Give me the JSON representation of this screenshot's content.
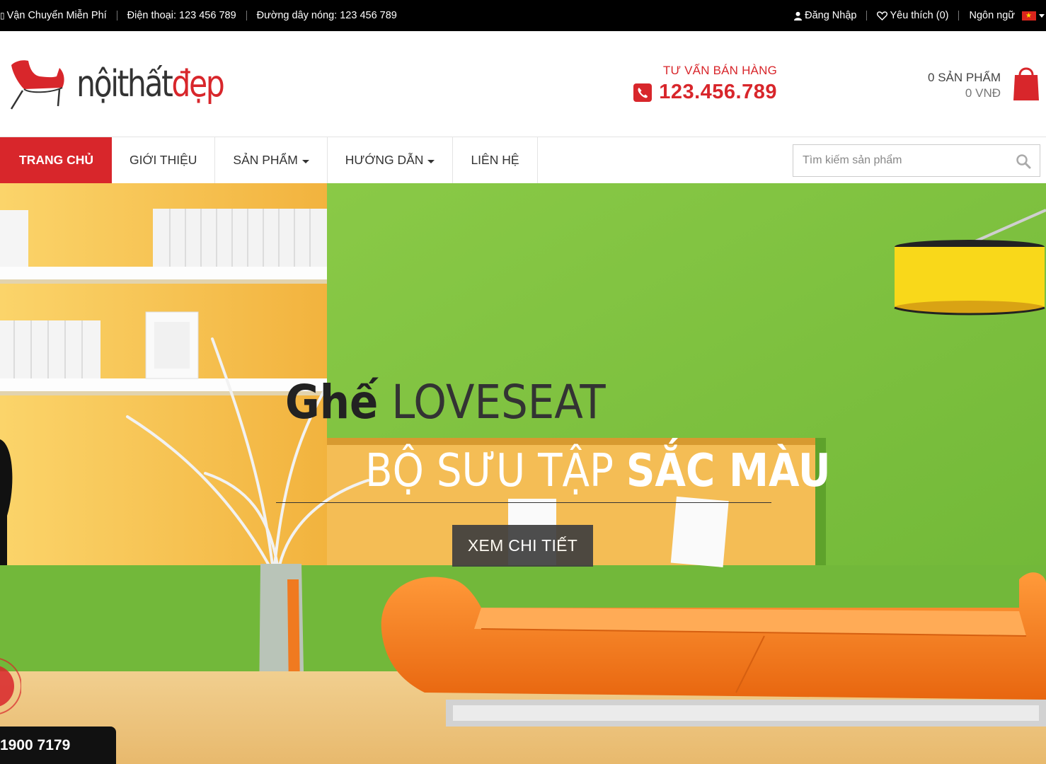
{
  "topbar": {
    "shipping": "Vận Chuyển Miễn Phí",
    "phone": "Điện thoại: 123 456 789",
    "hotline": "Đường dây nóng: 123 456 789",
    "login": "Đăng Nhập",
    "wishlist": "Yêu thích (0)",
    "language": "Ngôn ngữ"
  },
  "header": {
    "logo_dark": "nộithất",
    "logo_red": "đẹp",
    "consult_label": "TƯ VẤN BÁN HÀNG",
    "consult_number": "123.456.789",
    "cart_count": "0 SẢN PHẨM",
    "cart_total": "0 VNĐ"
  },
  "nav": {
    "items": [
      {
        "label": "TRANG CHỦ"
      },
      {
        "label": "GIỚI THIỆU"
      },
      {
        "label": "SẢN PHẨM"
      },
      {
        "label": "HƯỚNG DẪN"
      },
      {
        "label": "LIÊN HỆ"
      }
    ],
    "search_placeholder": "Tìm kiếm sản phẩm"
  },
  "slide": {
    "title_bold": "Ghế",
    "title_thin": "LOVESEAT",
    "subtitle_thin": "BỘ SƯU TẬP",
    "subtitle_bold": "SẮC MÀU",
    "button": "XEM CHI TIẾT"
  },
  "floating": {
    "phone": "1900 7179"
  },
  "colors": {
    "brand_red": "#d8262b",
    "topbar_bg": "#000000",
    "wall_green": "#7cc242",
    "wall_yellow": "#f6b94a",
    "sofa_orange": "#f27a1a"
  }
}
